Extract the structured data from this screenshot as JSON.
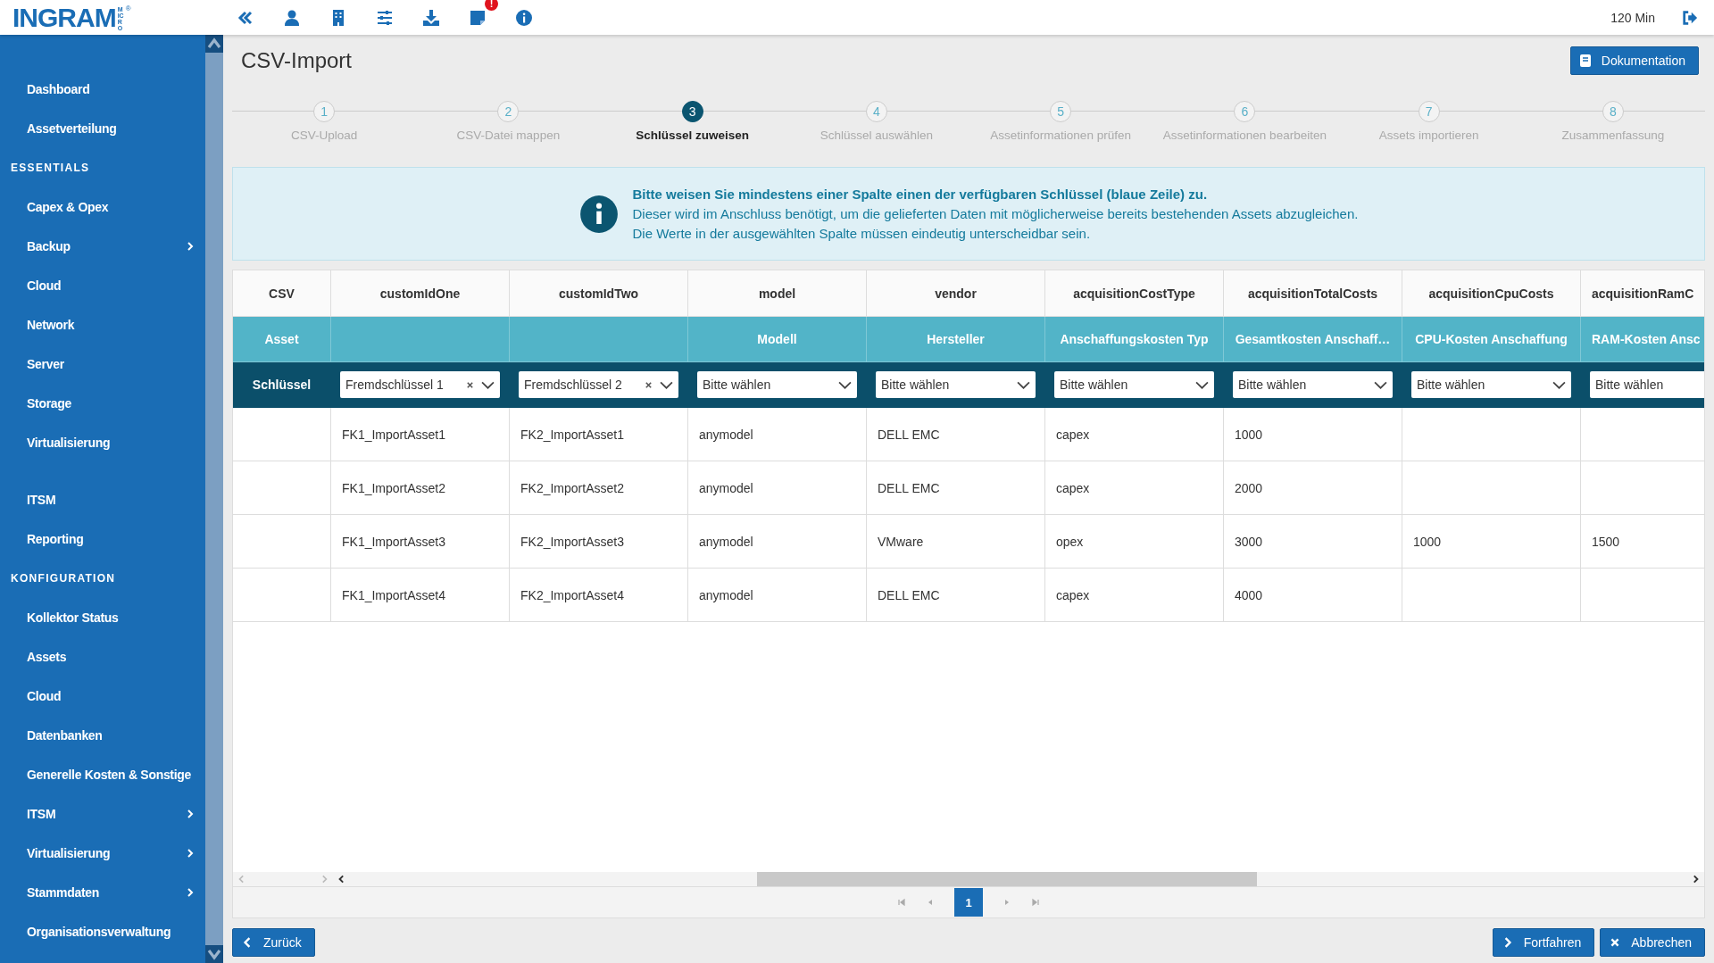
{
  "topbar": {
    "logo": {
      "name": "INGRAM",
      "sub": "MICRO",
      "mark": "®"
    },
    "badge": "!",
    "session": "120 Min"
  },
  "sidebar": {
    "sections": [
      {
        "items": [
          {
            "label": "Dashboard",
            "has_submenu": false
          },
          {
            "label": "Assetverteilung",
            "has_submenu": false
          }
        ]
      },
      {
        "heading": "ESSENTIALS",
        "items": [
          {
            "label": "Capex & Opex",
            "has_submenu": false
          },
          {
            "label": "Backup",
            "has_submenu": true
          },
          {
            "label": "Cloud",
            "has_submenu": false
          },
          {
            "label": "Network",
            "has_submenu": false
          },
          {
            "label": "Server",
            "has_submenu": false
          },
          {
            "label": "Storage",
            "has_submenu": false
          },
          {
            "label": "Virtualisierung",
            "has_submenu": false
          }
        ]
      },
      {
        "items": [
          {
            "label": "ITSM",
            "has_submenu": false
          },
          {
            "label": "Reporting",
            "has_submenu": false
          }
        ]
      },
      {
        "heading": "KONFIGURATION",
        "items": [
          {
            "label": "Kollektor Status",
            "has_submenu": false
          },
          {
            "label": "Assets",
            "has_submenu": false
          },
          {
            "label": "Cloud",
            "has_submenu": false
          },
          {
            "label": "Datenbanken",
            "has_submenu": false
          },
          {
            "label": "Generelle Kosten & Sonstige",
            "has_submenu": false
          },
          {
            "label": "ITSM",
            "has_submenu": true
          },
          {
            "label": "Virtualisierung",
            "has_submenu": true
          },
          {
            "label": "Stammdaten",
            "has_submenu": true
          },
          {
            "label": "Organisationsverwaltung",
            "has_submenu": false
          }
        ]
      }
    ]
  },
  "page": {
    "title": "CSV-Import",
    "doc_button": "Dokumentation"
  },
  "steps": [
    {
      "number": "1",
      "label": "CSV-Upload",
      "selected": false
    },
    {
      "number": "2",
      "label": "CSV-Datei mappen",
      "selected": false
    },
    {
      "number": "3",
      "label": "Schlüssel zuweisen",
      "selected": true
    },
    {
      "number": "4",
      "label": "Schlüssel auswählen",
      "selected": false
    },
    {
      "number": "5",
      "label": "Assetinformationen prüfen",
      "selected": false
    },
    {
      "number": "6",
      "label": "Assetinformationen bearbeiten",
      "selected": false
    },
    {
      "number": "7",
      "label": "Assets importieren",
      "selected": false
    },
    {
      "number": "8",
      "label": "Zusammenfassung",
      "selected": false
    }
  ],
  "info": {
    "headline": "Bitte weisen Sie mindestens einer Spalte einen der verfügbaren Schlüssel (blaue Zeile) zu.",
    "lines": [
      "Dieser wird im Anschluss benötigt, um die gelieferten Daten mit möglicherweise bereits bestehenden Assets abzugleichen.",
      "Die Werte in der ausgewählten Spalte müssen eindeutig unterscheidbar sein."
    ]
  },
  "table": {
    "row_labels": {
      "csv": "CSV",
      "asset": "Asset",
      "key": "Schlüssel"
    },
    "columns": [
      {
        "csv": "customIdOne",
        "key": {
          "value": "Fremdschlüssel 1",
          "clearable": true
        }
      },
      {
        "csv": "customIdTwo",
        "key": {
          "value": "Fremdschlüssel 2",
          "clearable": true
        }
      },
      {
        "csv": "model",
        "asset": "Modell",
        "key": {
          "placeholder": "Bitte wählen",
          "clearable": false
        }
      },
      {
        "csv": "vendor",
        "asset": "Hersteller",
        "key": {
          "placeholder": "Bitte wählen",
          "clearable": false
        }
      },
      {
        "csv": "acquisitionCostType",
        "asset": "Anschaffungskosten Typ",
        "key": {
          "placeholder": "Bitte wählen",
          "clearable": false
        }
      },
      {
        "csv": "acquisitionTotalCosts",
        "asset": "Gesamtkosten Anschaff…",
        "key": {
          "placeholder": "Bitte wählen",
          "clearable": false
        }
      },
      {
        "csv": "acquisitionCpuCosts",
        "asset": "CPU-Kosten Anschaffung",
        "key": {
          "placeholder": "Bitte wählen",
          "clearable": false
        }
      },
      {
        "csv": "acquisitionRamC",
        "asset": "RAM-Kosten Ansc",
        "key": {
          "placeholder": "Bitte wählen",
          "clearable": false
        }
      }
    ],
    "rows": [
      {
        "cells": [
          "FK1_ImportAsset1",
          "FK2_ImportAsset1",
          "anymodel",
          "DELL EMC",
          "capex",
          "1000",
          null,
          null
        ]
      },
      {
        "cells": [
          "FK1_ImportAsset2",
          "FK2_ImportAsset2",
          "anymodel",
          "DELL EMC",
          "capex",
          "2000",
          null,
          null
        ]
      },
      {
        "cells": [
          "FK1_ImportAsset3",
          "FK2_ImportAsset3",
          "anymodel",
          "VMware",
          "opex",
          "3000",
          "1000",
          "1500"
        ]
      },
      {
        "cells": [
          "FK1_ImportAsset4",
          "FK2_ImportAsset4",
          "anymodel",
          "DELL EMC",
          "capex",
          "4000",
          null,
          null
        ]
      }
    ]
  },
  "pagination": {
    "pages": [
      {
        "label": "1",
        "selected": true
      }
    ]
  },
  "footer": {
    "back": "Zurück",
    "next": "Fortfahren",
    "cancel": "Abbrechen"
  }
}
